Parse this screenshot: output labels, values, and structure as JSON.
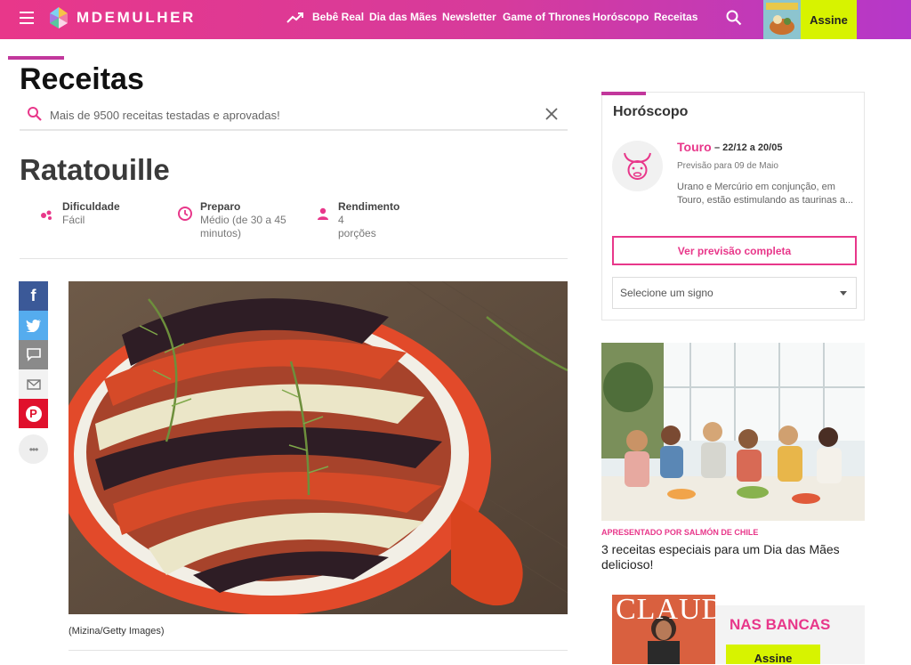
{
  "header": {
    "logo_text": "MDEMULHER",
    "nav": [
      "Bebê Real",
      "Dia das Mães",
      "Newsletter",
      "Game of Thrones",
      "Horóscopo",
      "Receitas"
    ],
    "subscribe_label": "Assine"
  },
  "section": {
    "title": "Receitas",
    "search_placeholder": "Mais de 9500 receitas testadas e aprovadas!"
  },
  "recipe": {
    "title": "Ratatouille",
    "meta": [
      {
        "label": "Dificuldade",
        "value": "Fácil",
        "icon": "difficulty-dots-icon"
      },
      {
        "label": "Preparo",
        "value": "Médio (de 30 a 45 minutos)",
        "icon": "clock-icon"
      },
      {
        "label": "Rendimento",
        "value": "4 porções",
        "icon": "person-icon"
      }
    ],
    "image_caption": "(Mizina/Getty Images)"
  },
  "share": [
    {
      "icon": "facebook-icon",
      "label": "f",
      "color": "#3b5998"
    },
    {
      "icon": "twitter-icon",
      "label": "",
      "color": "#55acee"
    },
    {
      "icon": "comment-icon",
      "label": "",
      "color": "#8a8a8a"
    },
    {
      "icon": "email-icon",
      "label": "",
      "color": "#f2f2f2"
    },
    {
      "icon": "pinterest-icon",
      "label": "P",
      "color": "#e0102c"
    },
    {
      "icon": "more-icon",
      "label": "•••",
      "color": "#eeeeee"
    }
  ],
  "horoscope": {
    "title": "Horóscopo",
    "sign": "Touro",
    "dates": "– 22/12 a 20/05",
    "forecast_date": "Previsão para 09 de Maio",
    "text": "Urano e Mercúrio em conjunção, em Touro, estão estimulando as taurinas a...",
    "button_label": "Ver previsão completa",
    "select_placeholder": "Selecione um signo"
  },
  "promo": {
    "tag": "APRESENTADO POR SALMÓN DE CHILE",
    "title": "3 receitas especiais para um Dia das Mães delicioso!"
  },
  "newsstand": {
    "title": "NAS BANCAS",
    "cover_title": "CLAUDIA",
    "button_label": "Assine"
  },
  "colors": {
    "brand_pink": "#e8378a",
    "brand_purple": "#b538c9",
    "accent_lime": "#d7f300"
  }
}
